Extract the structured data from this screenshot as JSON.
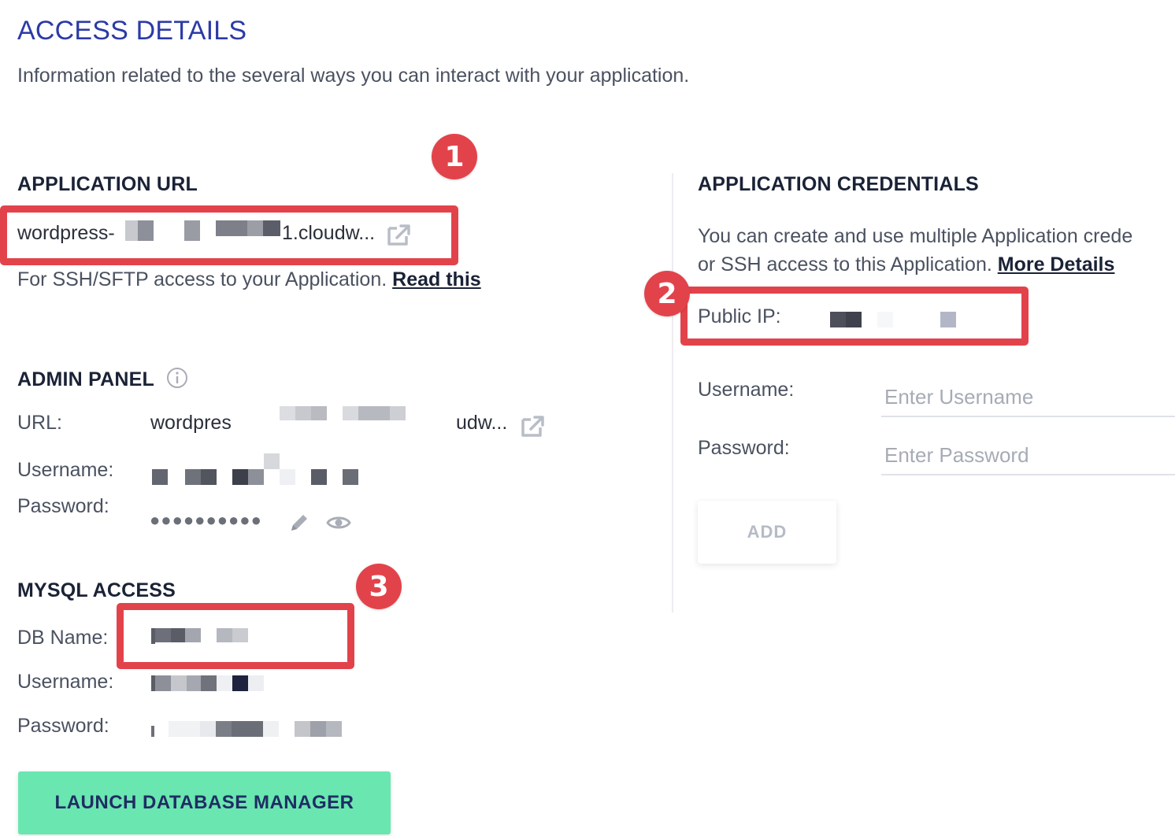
{
  "header": {
    "title": "ACCESS DETAILS",
    "subtitle": "Information related to the several ways you can interact with your application."
  },
  "app_url": {
    "heading": "APPLICATION URL",
    "url_prefix": "wordpress-",
    "url_suffix": "1.cloudw...",
    "ssh_note": "For SSH/SFTP access to your Application.",
    "ssh_link": "Read this"
  },
  "admin_panel": {
    "heading": "ADMIN PANEL",
    "url_label": "URL:",
    "url_prefix": "wordpres",
    "url_suffix": "udw...",
    "username_label": "Username:",
    "password_label": "Password:",
    "password_mask": "●●●●●●●●●●"
  },
  "mysql": {
    "heading": "MYSQL ACCESS",
    "db_name_label": "DB Name:",
    "username_label": "Username:",
    "password_label": "Password:",
    "launch_button": "LAUNCH DATABASE MANAGER"
  },
  "credentials": {
    "heading": "APPLICATION CREDENTIALS",
    "desc_line1": "You can create and use multiple Application crede",
    "desc_line2": "or SSH access to this Application.",
    "more_link": "More Details",
    "public_ip_label": "Public IP:",
    "username_label": "Username:",
    "username_placeholder": "Enter Username",
    "password_label": "Password:",
    "password_placeholder": "Enter Password",
    "add_button": "ADD"
  },
  "callouts": [
    "1",
    "2",
    "3"
  ],
  "colors": {
    "title": "#2c3aa6",
    "callout_red": "#e2434b",
    "launch_green": "#6ae6b0",
    "launch_text": "#1f2d63"
  },
  "icons": {
    "external_link": "external-link-icon",
    "info": "info-icon",
    "edit": "pencil-icon",
    "reveal": "eye-icon"
  }
}
